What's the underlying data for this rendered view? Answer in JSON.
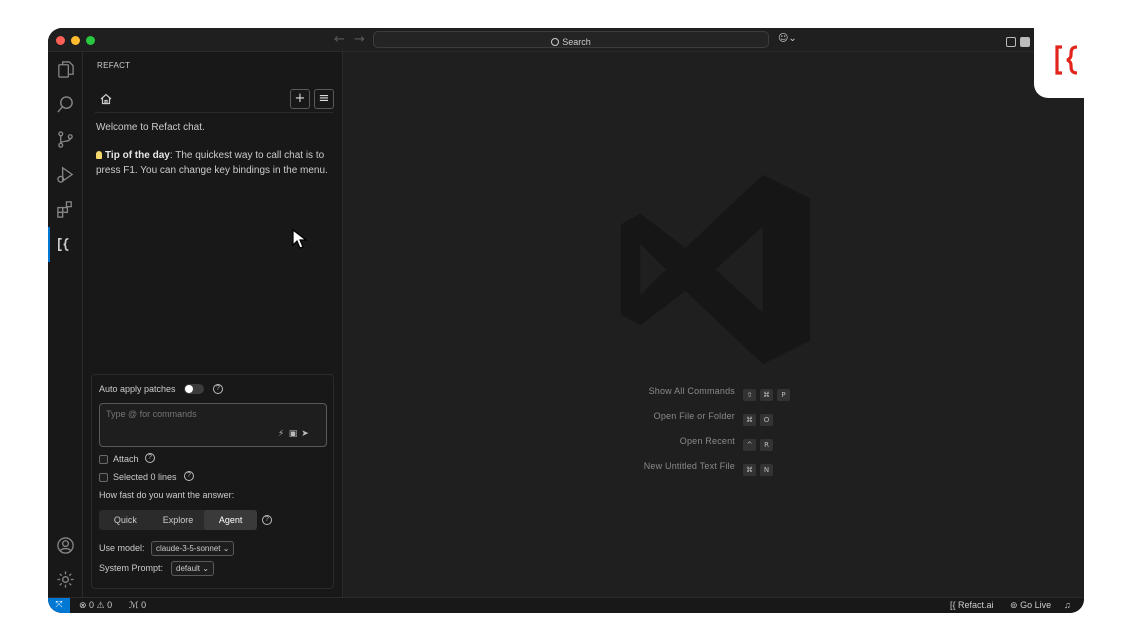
{
  "titlebar": {
    "back": "←",
    "forward": "→",
    "search_label": "Search"
  },
  "activity_bar": {
    "items": [
      "explorer-icon",
      "search-icon",
      "source-control-icon",
      "run-debug-icon",
      "extensions-icon",
      "refact-icon"
    ],
    "bottom": [
      "accounts-icon",
      "settings-icon"
    ]
  },
  "sidebar": {
    "title": "REFACT",
    "new_chat": "+",
    "menu": "≡",
    "welcome": "Welcome to Refact chat.",
    "tip_label": "Tip of the day",
    "tip_text": ": The quickest way to call chat is to press F1. You can change key bindings in the menu."
  },
  "chat_panel": {
    "auto_apply_label": "Auto apply patches",
    "input_placeholder": "Type @ for commands",
    "attach_label": "Attach",
    "selected_lines_label": "Selected 0 lines",
    "speed_question": "How fast do you want the answer:",
    "modes": [
      "Quick",
      "Explore",
      "Agent"
    ],
    "selected_mode": "Agent",
    "model_label": "Use model:",
    "model_value": "claude-3-5-sonnet",
    "system_prompt_label": "System Prompt:",
    "system_prompt_value": "default"
  },
  "editor": {
    "shortcuts": [
      {
        "label": "Show All Commands",
        "keys": [
          "⇧",
          "⌘",
          "P"
        ]
      },
      {
        "label": "Open File or Folder",
        "keys": [
          "⌘",
          "O"
        ]
      },
      {
        "label": "Open Recent",
        "keys": [
          "^",
          "R"
        ]
      },
      {
        "label": "New Untitled Text File",
        "keys": [
          "⌘",
          "N"
        ]
      }
    ]
  },
  "statusbar": {
    "problems": "⊗ 0 ⚠ 0",
    "ports": "0",
    "refact": "Refact.ai",
    "go_live": "Go Live"
  },
  "colors": {
    "accent": "#0078d4",
    "brand_red": "#e1251b",
    "background": "#181818"
  }
}
